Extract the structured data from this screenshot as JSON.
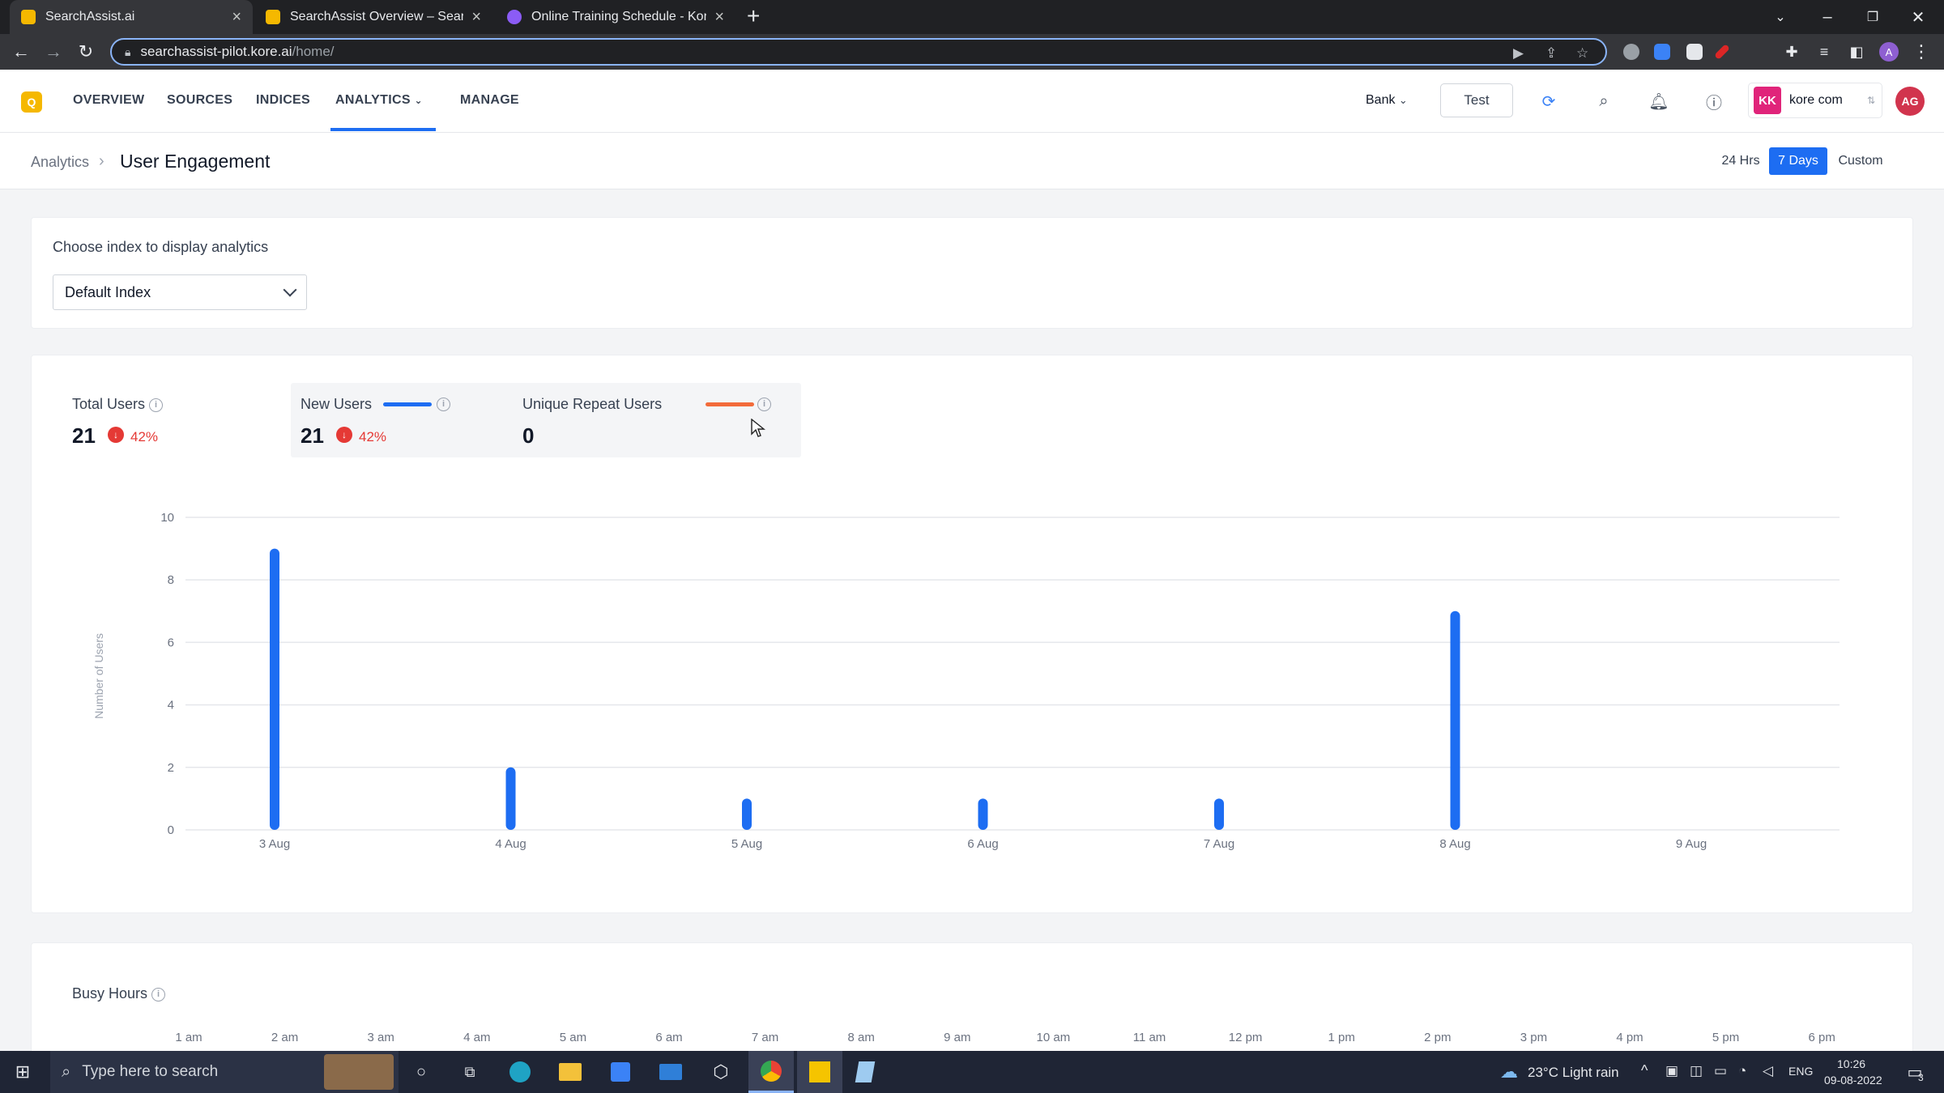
{
  "browser": {
    "tabs": [
      {
        "title": "SearchAssist.ai",
        "favicon_color": "#f5b800",
        "active": true
      },
      {
        "title": "SearchAssist Overview – SearchA",
        "favicon_color": "#f5b800",
        "active": false
      },
      {
        "title": "Online Training Schedule - Kore.a",
        "favicon_color": "#8b5cf6",
        "active": false
      }
    ],
    "url_host": "searchassist-pilot.kore.ai",
    "url_path": "/home/",
    "profile_initial": "A"
  },
  "app": {
    "nav": [
      {
        "label": "OVERVIEW"
      },
      {
        "label": "SOURCES"
      },
      {
        "label": "INDICES"
      },
      {
        "label": "ANALYTICS",
        "active": true
      },
      {
        "label": "MANAGE"
      }
    ],
    "bot_name": "Bank",
    "test_label": "Test",
    "account_initials": "KK",
    "account_name": "kore com",
    "user_initials": "AG"
  },
  "breadcrumb": {
    "parent": "Analytics",
    "current": "User Engagement"
  },
  "date_range": {
    "options": [
      "24 Hrs",
      "7 Days",
      "Custom"
    ],
    "selected": "7 Days"
  },
  "index_selector": {
    "label": "Choose index to display analytics",
    "value": "Default Index"
  },
  "metrics": {
    "total_users": {
      "label": "Total Users",
      "value": "21",
      "change": "42%"
    },
    "new_users": {
      "label": "New Users",
      "value": "21",
      "change": "42%",
      "color": "#1d6df2"
    },
    "repeat_users": {
      "label": "Unique Repeat Users",
      "value": "0",
      "color": "#f26b3a"
    }
  },
  "chart_data": {
    "type": "bar",
    "title": "",
    "xlabel": "",
    "ylabel": "Number of Users",
    "categories": [
      "3 Aug",
      "4 Aug",
      "5 Aug",
      "6 Aug",
      "7 Aug",
      "8 Aug",
      "9 Aug"
    ],
    "series": [
      {
        "name": "New Users",
        "values": [
          9,
          2,
          1,
          1,
          1,
          7,
          0
        ],
        "color": "#1d6df2"
      },
      {
        "name": "Unique Repeat Users",
        "values": [
          0,
          0,
          0,
          0,
          0,
          0,
          0
        ],
        "color": "#f26b3a"
      }
    ],
    "yticks": [
      0,
      2,
      4,
      6,
      8,
      10
    ],
    "ylim": [
      0,
      10
    ],
    "grid": true
  },
  "busy_hours": {
    "title": "Busy Hours",
    "hours": [
      "1 am",
      "2 am",
      "3 am",
      "4 am",
      "5 am",
      "6 am",
      "7 am",
      "8 am",
      "9 am",
      "10 am",
      "11 am",
      "12 pm",
      "1 pm",
      "2 pm",
      "3 pm",
      "4 pm",
      "5 pm",
      "6 pm"
    ]
  },
  "taskbar": {
    "search_placeholder": "Type here to search",
    "weather": "23°C  Light rain",
    "language": "ENG",
    "time": "10:26",
    "date": "09-08-2022",
    "notifications": "3"
  }
}
